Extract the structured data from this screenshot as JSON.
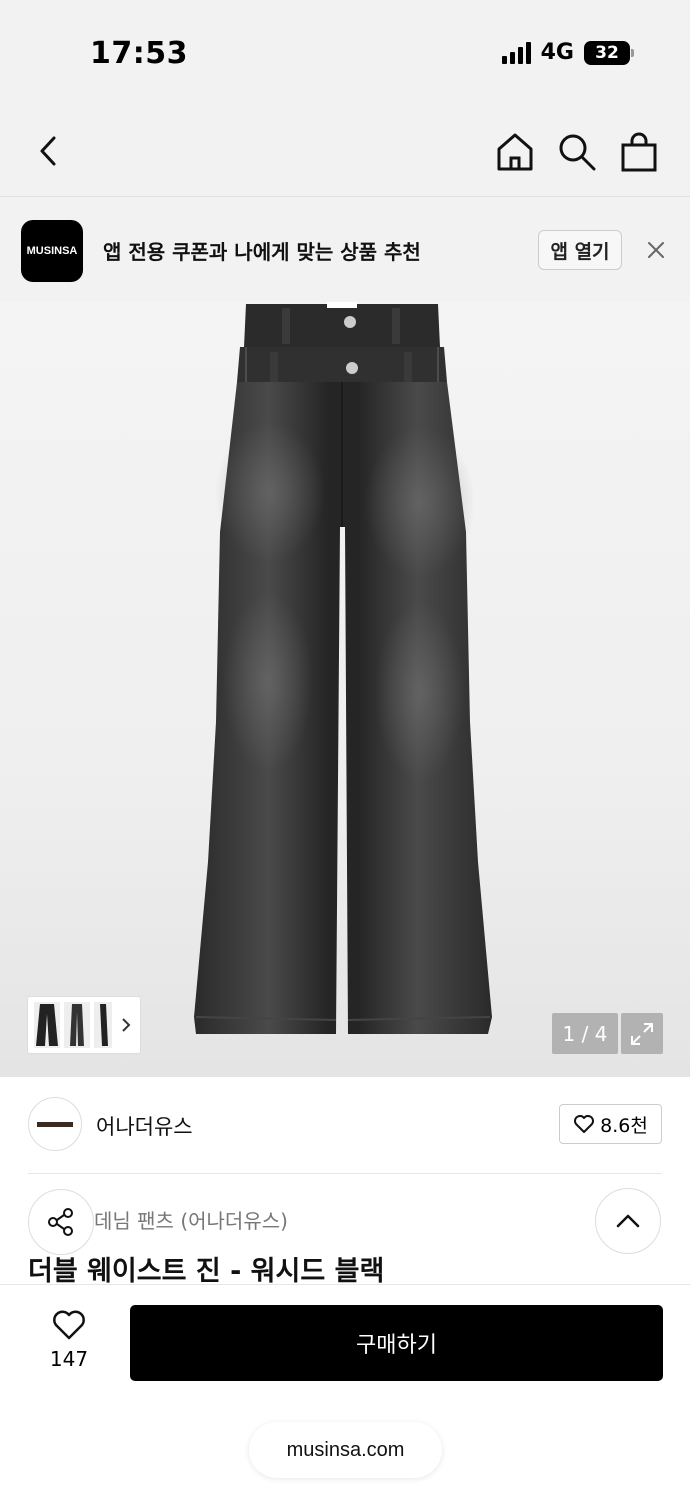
{
  "status_bar": {
    "time": "17:53",
    "network": "4G",
    "battery": "32"
  },
  "top_nav": {
    "icons": [
      "back-icon",
      "home-icon",
      "search-icon",
      "bag-icon"
    ]
  },
  "app_banner": {
    "logo_text": "MUSINSA",
    "message": "앱 전용 쿠폰과 나에게 맞는 상품 추천",
    "open_button": "앱 열기"
  },
  "gallery": {
    "counter": "1 / 4",
    "current": 1,
    "total": 4
  },
  "brand": {
    "name": "어나더유스",
    "likes": "8.6천"
  },
  "product": {
    "category": "데님 팬츠 (어나더유스)",
    "title": "더블 웨이스트 진 - 워시드 블랙"
  },
  "bottom_bar": {
    "like_count": "147",
    "buy_label": "구매하기"
  },
  "browser": {
    "url": "musinsa.com"
  },
  "colors": {
    "accent": "#000000",
    "background": "#f2f2f2"
  }
}
